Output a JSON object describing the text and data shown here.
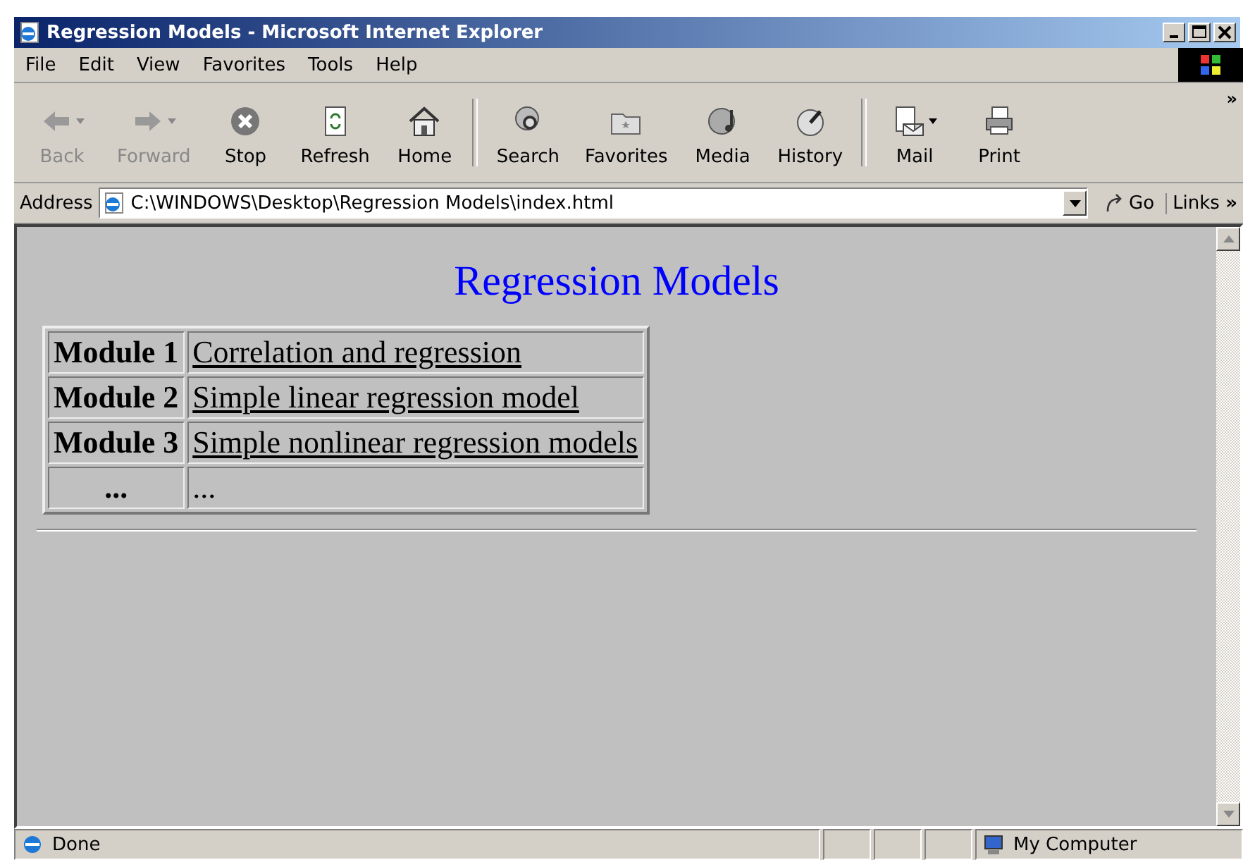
{
  "window": {
    "title": "Regression Models - Microsoft Internet Explorer"
  },
  "menu": [
    "File",
    "Edit",
    "View",
    "Favorites",
    "Tools",
    "Help"
  ],
  "toolbar": [
    {
      "label": "Back",
      "kind": "back",
      "disabled": true,
      "dropdown": true
    },
    {
      "label": "Forward",
      "kind": "forward",
      "disabled": true,
      "dropdown": true
    },
    {
      "label": "Stop",
      "kind": "stop",
      "disabled": false,
      "dropdown": false
    },
    {
      "label": "Refresh",
      "kind": "refresh",
      "disabled": false,
      "dropdown": false
    },
    {
      "label": "Home",
      "kind": "home",
      "disabled": false,
      "dropdown": false
    },
    {
      "kind": "separator"
    },
    {
      "label": "Search",
      "kind": "search",
      "disabled": false,
      "dropdown": false
    },
    {
      "label": "Favorites",
      "kind": "favorites",
      "disabled": false,
      "dropdown": false
    },
    {
      "label": "Media",
      "kind": "media",
      "disabled": false,
      "dropdown": false
    },
    {
      "label": "History",
      "kind": "history",
      "disabled": false,
      "dropdown": false
    },
    {
      "kind": "separator"
    },
    {
      "label": "Mail",
      "kind": "mail",
      "disabled": false,
      "dropdown": true
    },
    {
      "label": "Print",
      "kind": "print",
      "disabled": false,
      "dropdown": false
    }
  ],
  "toolbar_chevron": "»",
  "address": {
    "label": "Address",
    "value": "C:\\WINDOWS\\Desktop\\Regression Models\\index.html",
    "go": "Go",
    "links": "Links",
    "links_chevron": "»"
  },
  "page": {
    "heading": "Regression Models",
    "table": {
      "rows": [
        {
          "module": "Module 1",
          "topic": "Correlation and regression",
          "link": true
        },
        {
          "module": "Module 2",
          "topic": "Simple linear regression model",
          "link": true
        },
        {
          "module": "Module 3",
          "topic": "Simple nonlinear regression models",
          "link": true
        },
        {
          "module": "...",
          "topic": "...",
          "link": false
        }
      ]
    }
  },
  "status_bar": {
    "text": "Done",
    "zone": "My Computer"
  }
}
